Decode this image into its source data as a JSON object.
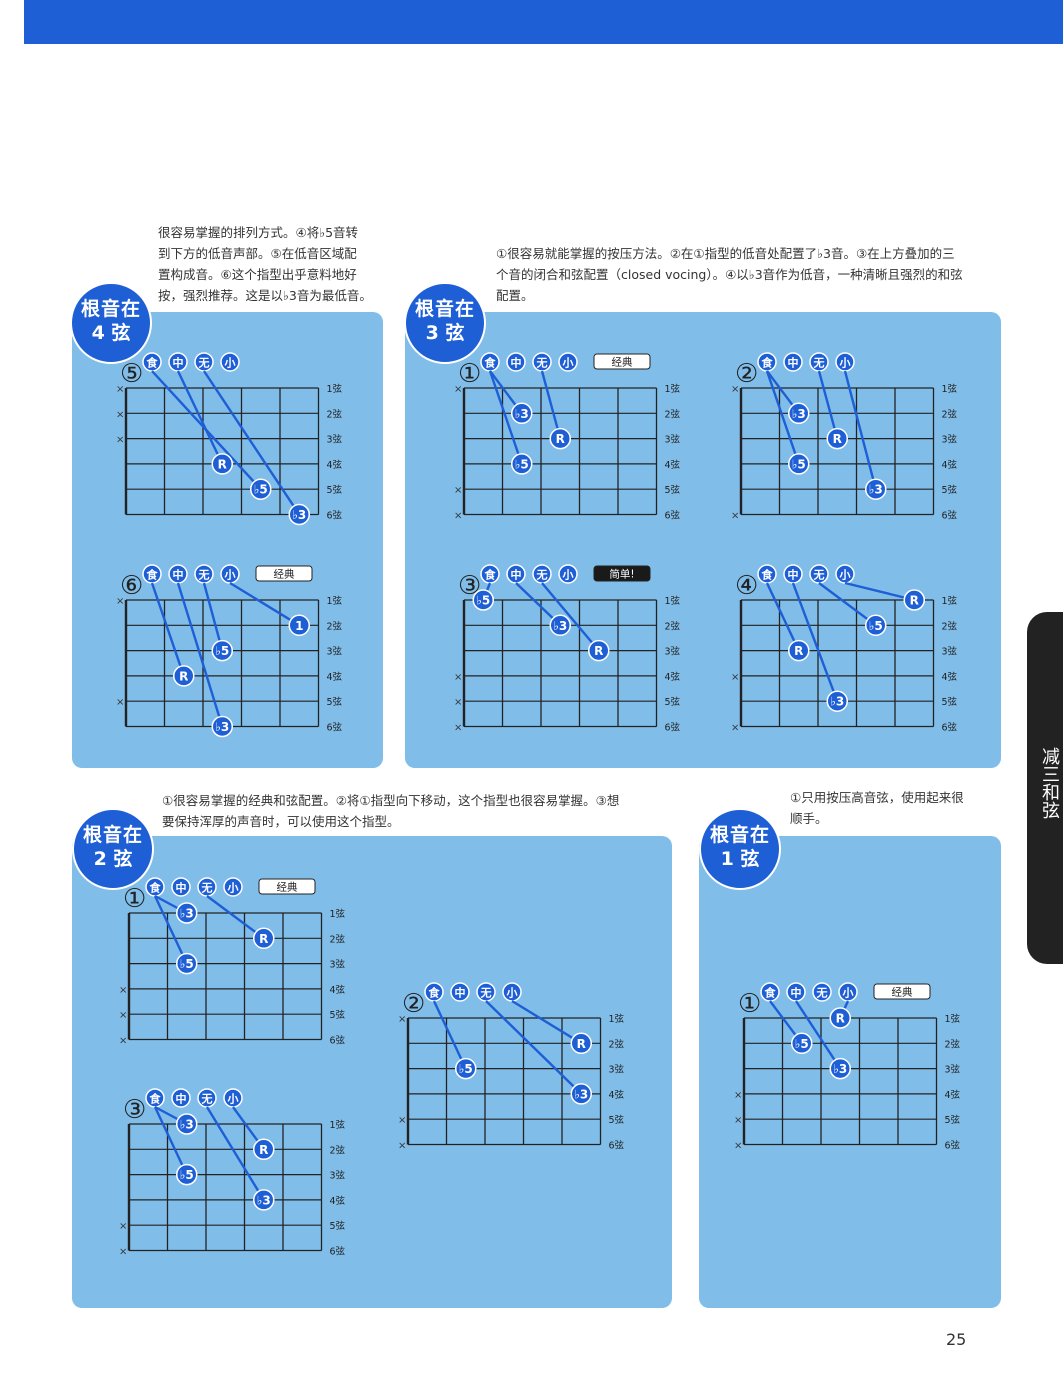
{
  "page_number": "25",
  "side_tab": "减三和弦",
  "string_labels": [
    "1弦",
    "2弦",
    "3弦",
    "4弦",
    "5弦",
    "6弦"
  ],
  "finger_labels": [
    "食",
    "中",
    "无",
    "小"
  ],
  "tags": {
    "classic": "经典",
    "easy": "简单!"
  },
  "sections": {
    "s4": {
      "badge_line1": "根音在",
      "badge_line2": "4 弦",
      "desc": [
        "很容易掌握的排列方式。④将♭5音转",
        "到下方的低音声部。⑤在低音区域配",
        "置构成音。⑥这个指型出乎意料地好",
        "按，强烈推荐。这是以♭3音为最低音。"
      ]
    },
    "s3": {
      "badge_line1": "根音在",
      "badge_line2": "3 弦",
      "desc": [
        "①很容易就能掌握的按压方法。②在①指型的低音处配置了♭3音。③在上方叠加的三",
        "个音的闭合和弦配置（closed vocing）。④以♭3音作为低音，一种清晰且强烈的和弦",
        "配置。"
      ]
    },
    "s2": {
      "badge_line1": "根音在",
      "badge_line2": "2 弦",
      "desc": [
        "①很容易掌握的经典和弦配置。②将①指型向下移动，这个指型也很容易掌握。③想",
        "要保持浑厚的声音时，可以使用这个指型。"
      ]
    },
    "s1": {
      "badge_line1": "根音在",
      "badge_line2": "1 弦",
      "desc": [
        "①只用按压高音弦，使用起来很",
        "顺手。"
      ]
    }
  },
  "diagrams": [
    {
      "id": "d4-5",
      "number": "⑤",
      "tag": "",
      "muted": [
        1,
        2,
        3
      ],
      "notes": [
        {
          "label": "♭5",
          "string": 5,
          "fret": 4,
          "finger": 1
        },
        {
          "label": "R",
          "string": 4,
          "fret": 3,
          "finger": 2
        },
        {
          "label": "♭3",
          "string": 6,
          "fret": 5,
          "finger": 3
        }
      ]
    },
    {
      "id": "d4-6",
      "number": "⑥",
      "tag": "classic",
      "muted": [
        1,
        5
      ],
      "notes": [
        {
          "label": "1",
          "string": 2,
          "fret": 5,
          "finger": 4
        },
        {
          "label": "♭5",
          "string": 3,
          "fret": 3,
          "finger": 3
        },
        {
          "label": "R",
          "string": 4,
          "fret": 2,
          "finger": 1
        },
        {
          "label": "♭3",
          "string": 6,
          "fret": 3,
          "finger": 2
        }
      ]
    },
    {
      "id": "d3-1",
      "number": "①",
      "tag": "classic",
      "muted": [
        1,
        5,
        6
      ],
      "notes": [
        {
          "label": "♭3",
          "string": 2,
          "fret": 2,
          "finger": 1
        },
        {
          "label": "R",
          "string": 3,
          "fret": 3,
          "finger": 3
        },
        {
          "label": "♭5",
          "string": 4,
          "fret": 2,
          "finger": 1
        }
      ]
    },
    {
      "id": "d3-2",
      "number": "②",
      "tag": "",
      "muted": [
        1,
        6
      ],
      "notes": [
        {
          "label": "♭3",
          "string": 2,
          "fret": 2,
          "finger": 1
        },
        {
          "label": "R",
          "string": 3,
          "fret": 3,
          "finger": 3
        },
        {
          "label": "♭5",
          "string": 4,
          "fret": 2,
          "finger": 1
        },
        {
          "label": "♭3",
          "string": 5,
          "fret": 4,
          "finger": 4
        }
      ]
    },
    {
      "id": "d3-3",
      "number": "③",
      "tag": "easy",
      "muted": [
        4,
        5,
        6
      ],
      "notes": [
        {
          "label": "♭5",
          "string": 1,
          "fret": 1,
          "finger": 1
        },
        {
          "label": "♭3",
          "string": 2,
          "fret": 3,
          "finger": 2
        },
        {
          "label": "R",
          "string": 3,
          "fret": 4,
          "finger": 3
        }
      ]
    },
    {
      "id": "d3-4",
      "number": "④",
      "tag": "",
      "muted": [
        4,
        6
      ],
      "notes": [
        {
          "label": "R",
          "string": 1,
          "fret": 5,
          "finger": 4
        },
        {
          "label": "♭5",
          "string": 2,
          "fret": 4,
          "finger": 3
        },
        {
          "label": "R",
          "string": 3,
          "fret": 2,
          "finger": 1
        },
        {
          "label": "♭3",
          "string": 5,
          "fret": 3,
          "finger": 2
        }
      ]
    },
    {
      "id": "d2-1",
      "number": "①",
      "tag": "classic",
      "muted": [
        4,
        5,
        6
      ],
      "notes": [
        {
          "label": "♭3",
          "string": 1,
          "fret": 2,
          "finger": 1
        },
        {
          "label": "R",
          "string": 2,
          "fret": 4,
          "finger": 3
        },
        {
          "label": "♭5",
          "string": 3,
          "fret": 2,
          "finger": 1
        }
      ]
    },
    {
      "id": "d2-2",
      "number": "②",
      "tag": "",
      "muted": [
        1,
        5,
        6
      ],
      "notes": [
        {
          "label": "R",
          "string": 2,
          "fret": 5,
          "finger": 4
        },
        {
          "label": "♭5",
          "string": 3,
          "fret": 2,
          "finger": 1
        },
        {
          "label": "♭3",
          "string": 4,
          "fret": 5,
          "finger": 3
        }
      ]
    },
    {
      "id": "d2-3",
      "number": "③",
      "tag": "",
      "muted": [
        5,
        6
      ],
      "notes": [
        {
          "label": "♭3",
          "string": 1,
          "fret": 2,
          "finger": 1
        },
        {
          "label": "R",
          "string": 2,
          "fret": 4,
          "finger": 4
        },
        {
          "label": "♭5",
          "string": 3,
          "fret": 2,
          "finger": 1
        },
        {
          "label": "♭3",
          "string": 4,
          "fret": 4,
          "finger": 3
        }
      ]
    },
    {
      "id": "d1-1",
      "number": "①",
      "tag": "classic",
      "muted": [
        4,
        5,
        6
      ],
      "notes": [
        {
          "label": "R",
          "string": 1,
          "fret": 3,
          "finger": 4
        },
        {
          "label": "♭5",
          "string": 2,
          "fret": 2,
          "finger": 1
        },
        {
          "label": "♭3",
          "string": 3,
          "fret": 3,
          "finger": 2
        }
      ]
    }
  ]
}
